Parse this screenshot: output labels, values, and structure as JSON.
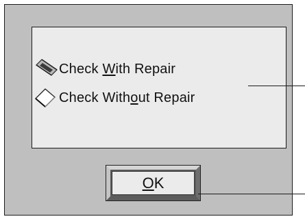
{
  "dialog": {
    "options": [
      {
        "label_before": "Check ",
        "mnemonic": "W",
        "label_after": "ith Repair",
        "selected": true
      },
      {
        "label_before": "Check With",
        "mnemonic": "o",
        "label_after": "ut Repair",
        "selected": false
      }
    ],
    "ok_button": {
      "mnemonic": "O",
      "label_after": "K"
    }
  }
}
